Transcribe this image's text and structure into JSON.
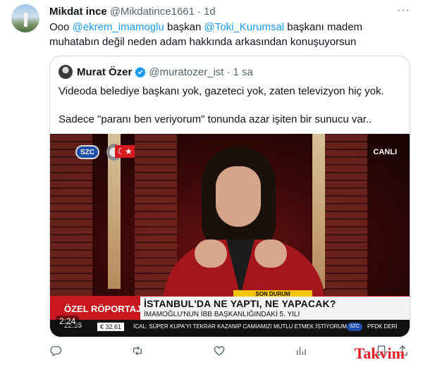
{
  "tweet": {
    "author_name": "Mikdat ince",
    "author_handle": "@Mikdatince1661",
    "separator": "·",
    "time": "1d",
    "more_label": "···",
    "text_before": "Ooo ",
    "mention_1": "@ekrem_imamoglu",
    "text_mid": " başkan ",
    "mention_2": "@Toki_Kurumsal",
    "text_after": " başkanı madem muhatabın değil neden adam hakkında arkasından konuşuyorsun"
  },
  "quote": {
    "author_name": "Murat Özer",
    "author_handle": "@muratozer_ist",
    "separator": "·",
    "time": "1 sa",
    "line_1": "Videoda belediye başkanı yok, gazeteci yok, zaten televizyon hiç yok.",
    "line_2": "Sadece \"paranı ben veriyorum\" tonunda azar işiten bir sunucu var.."
  },
  "video": {
    "channel_logo": "SZC",
    "flag": "☾★",
    "live_label": "CANLI",
    "breaking_label": "SON DURUM",
    "segment_label": "ÖZEL RÖPORTAJ",
    "headline": "İSTANBUL'DA NE YAPTI, NE YAPACAK?",
    "subheadline": "İMAMOĞLU'NUN İBB BAŞKANLIĞINDAKİ 5. YILI",
    "clock": "22:35",
    "currency": "€ 32,61",
    "ticker": "İCAL: SÜPER KUPA'YI TEKRAR KAZANIP CAMİAMIZI MUTLU ETMEK İSTİYORUM",
    "ticker_logo": "SZC",
    "ticker_right": "PFDK DERİ",
    "duration": "2:24"
  },
  "watermark": "Takvim",
  "icons": [
    "reply-icon",
    "retweet-icon",
    "like-icon",
    "views-icon",
    "bookmark-icon",
    "share-icon",
    "verified-badge-icon"
  ],
  "colors": {
    "link": "#1d9bf0",
    "secondary": "#536471",
    "border": "#cfd9de",
    "tv_red": "#c8181e",
    "tv_yellow": "#f5c400"
  }
}
